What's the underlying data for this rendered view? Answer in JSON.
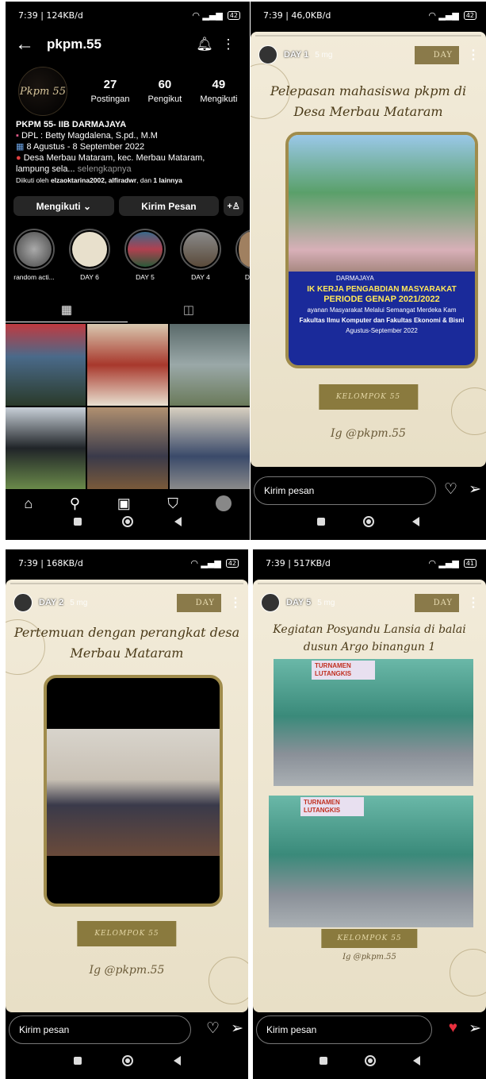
{
  "status": {
    "time1": "7:39 | 124KB/d",
    "time2": "7:39 | 46,0KB/d",
    "time3": "7:39 | 168KB/d",
    "time4": "7:39 | 517KB/d",
    "bat1": "42",
    "bat2": "42",
    "bat3": "42",
    "bat4": "41"
  },
  "profile": {
    "username": "pkpm.55",
    "avatar_text": "Pkpm 55",
    "posts_count": "27",
    "posts_label": "Postingan",
    "followers_count": "60",
    "followers_label": "Pengikut",
    "following_count": "49",
    "following_label": "Mengikuti",
    "bio_name": "PKPM 55- IIB DARMAJAYA",
    "bio_dpl": "DPL : Betty Magdalena, S.pd., M.M",
    "bio_date": "8 Agustus - 8 September 2022",
    "bio_loc": "Desa Merbau Mataram, kec. Merbau Mataram,",
    "bio_loc2": "lampung sela...",
    "bio_more": "selengkapnya",
    "followed_prefix": "Diikuti oleh ",
    "followed_names": "elzaoktarina2002, alfiradwr",
    "followed_suffix": ", dan ",
    "followed_more": "1 lainnya",
    "btn_following": "Mengikuti ⌄",
    "btn_message": "Kirim Pesan",
    "highlights": [
      {
        "label": "random acti..."
      },
      {
        "label": "DAY 6"
      },
      {
        "label": "DAY 5"
      },
      {
        "label": "DAY 4"
      },
      {
        "label": "D"
      }
    ]
  },
  "stories": [
    {
      "day": "DAY 1",
      "time": "5 mg",
      "banner": "DAY",
      "title": "Pelepasan mahasiswa pkpm di Desa Merbau Mataram",
      "banner_line1": "IK KERJA PENGABDIAN MASYARAKAT",
      "banner_line2": "PERIODE GENAP 2021/2022",
      "banner_line3": "ayanan Masyarakat Melalui Semangat Merdeka Kam",
      "banner_line4": "Fakultas Ilmu Komputer dan Fakultas Ekonomi & Bisni",
      "banner_line5": "Agustus-September 2022",
      "darmajaya": "DARMAJAYA",
      "kelompok": "KELOMPOK 55",
      "sig": "Ig @pkpm.55",
      "reply": "Kirim pesan"
    },
    {
      "day": "DAY 2",
      "time": "5 mg",
      "banner": "DAY",
      "title": "Pertemuan dengan perangkat desa Merbau Mataram",
      "kelompok": "KELOMPOK 55",
      "sig": "Ig @pkpm.55",
      "reply": "Kirim pesan"
    },
    {
      "day": "DAY 5",
      "time": "5 mg",
      "banner": "DAY",
      "title": "Kegiatan Posyandu Lansia di balai dusun Argo binangun 1",
      "sign_text": "TURNAMEN LUTANGKIS",
      "kelompok": "KELOMPOK 55",
      "sig": "Ig @pkpm.55",
      "reply": "Kirim pesan"
    }
  ]
}
